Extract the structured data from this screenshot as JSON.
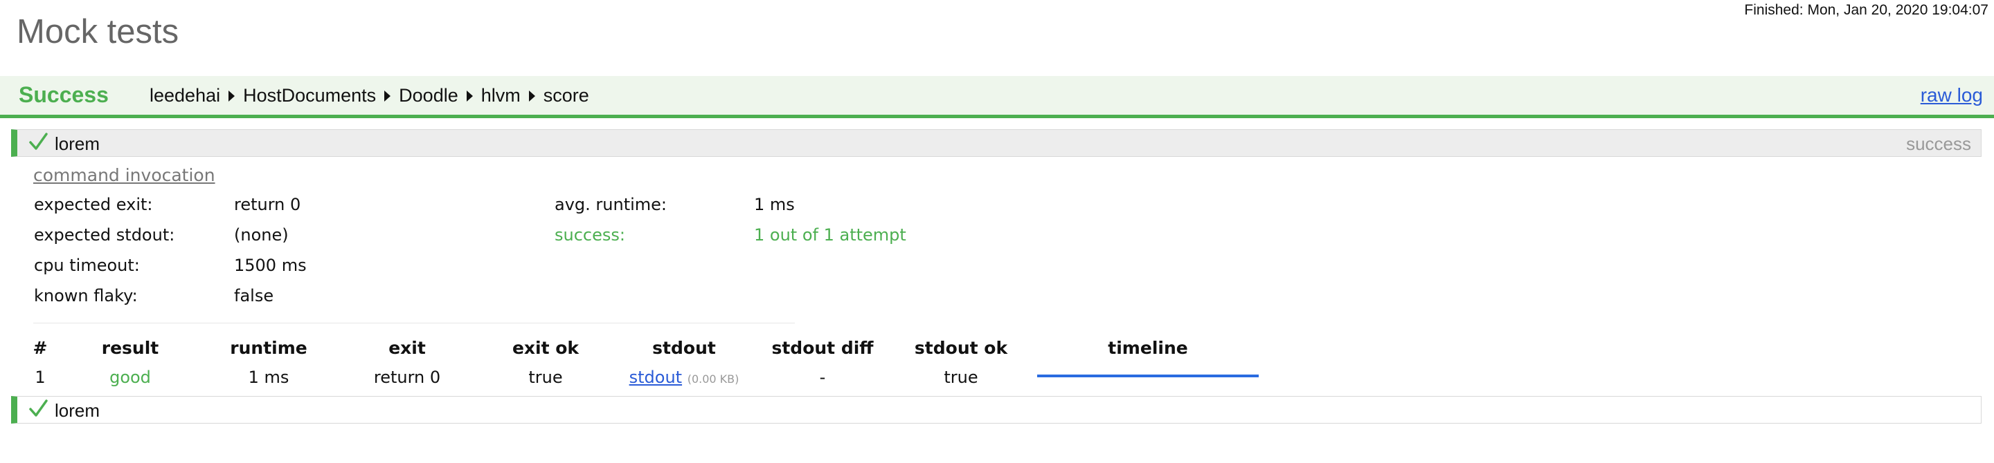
{
  "header": {
    "finished": "Finished: Mon, Jan 20, 2020 19:04:07",
    "title": "Mock tests"
  },
  "status_bar": {
    "status": "Success",
    "breadcrumb": [
      "leedehai",
      "HostDocuments",
      "Doodle",
      "hlvm",
      "score"
    ],
    "raw_log": "raw log"
  },
  "tests": [
    {
      "name": "lorem",
      "result": "success",
      "expanded": true,
      "command_invocation": "command invocation",
      "details_left": [
        {
          "label": "expected exit:",
          "value": "return 0"
        },
        {
          "label": "expected stdout:",
          "value": "(none)"
        },
        {
          "label": "cpu timeout:",
          "value": "1500 ms"
        },
        {
          "label": "known flaky:",
          "value": "false"
        }
      ],
      "details_right": [
        {
          "label": "avg. runtime:",
          "value": "1 ms"
        },
        {
          "label": "success:",
          "value": "1 out of 1 attempt"
        }
      ],
      "table": {
        "columns": [
          "#",
          "result",
          "runtime",
          "exit",
          "exit ok",
          "stdout",
          "stdout diff",
          "stdout ok",
          "timeline"
        ],
        "rows": [
          {
            "num": "1",
            "result": "good",
            "runtime": "1 ms",
            "exit": "return 0",
            "exit_ok": "true",
            "stdout": "stdout",
            "stdout_size": "(0.00 KB)",
            "stdout_diff": "-",
            "stdout_ok": "true"
          }
        ]
      }
    },
    {
      "name": "lorem",
      "expanded": false
    }
  ],
  "colors": {
    "success": "#4caf50",
    "link": "#2a5bd7",
    "timeline": "#2a6be0"
  }
}
